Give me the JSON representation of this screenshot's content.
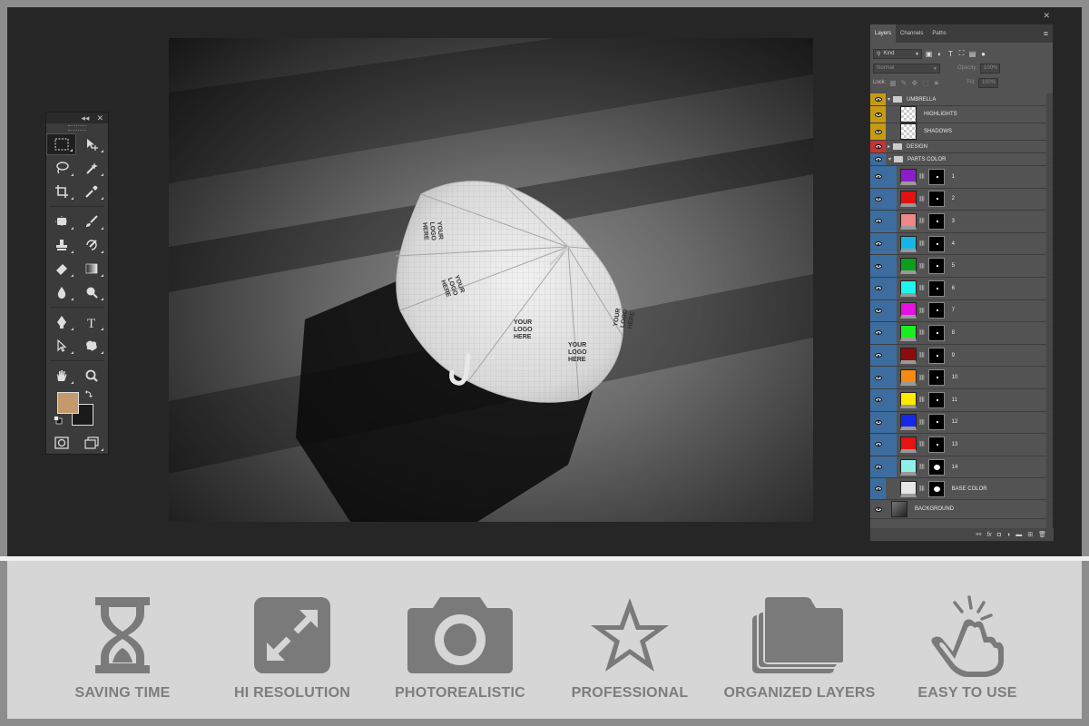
{
  "layers_panel": {
    "tabs": [
      {
        "label": "Layers",
        "active": true
      },
      {
        "label": "Channels",
        "active": false
      },
      {
        "label": "Paths",
        "active": false
      }
    ],
    "filter_kind": "Kind",
    "blend_mode": "Normal",
    "opacity_label": "Opacity:",
    "opacity_value": "100%",
    "lock_label": "Lock:",
    "fill_label": "Fill:",
    "fill_value": "100%",
    "layers": [
      {
        "name": "UMBRELLA",
        "type": "group",
        "color": "yellow",
        "expanded": true
      },
      {
        "name": "HIGHLIGHTS",
        "type": "smart",
        "color": "yellow"
      },
      {
        "name": "SHADOWS",
        "type": "smart",
        "color": "yellow"
      },
      {
        "name": "DESIGN",
        "type": "group",
        "color": "red",
        "expanded": false
      },
      {
        "name": "PARTS COLOR",
        "type": "group",
        "color": "blue",
        "expanded": true
      },
      {
        "name": "1",
        "type": "fill",
        "color": "blue",
        "swatch": "#8a1fc9"
      },
      {
        "name": "2",
        "type": "fill",
        "color": "blue",
        "swatch": "#e31111"
      },
      {
        "name": "3",
        "type": "fill",
        "color": "blue",
        "swatch": "#f08787"
      },
      {
        "name": "4",
        "type": "fill",
        "color": "blue",
        "swatch": "#17b5e6"
      },
      {
        "name": "5",
        "type": "fill",
        "color": "blue",
        "swatch": "#0e9e1d"
      },
      {
        "name": "6",
        "type": "fill",
        "color": "blue",
        "swatch": "#1ff5ee"
      },
      {
        "name": "7",
        "type": "fill",
        "color": "blue",
        "swatch": "#e511e3"
      },
      {
        "name": "8",
        "type": "fill",
        "color": "blue",
        "swatch": "#19f021"
      },
      {
        "name": "9",
        "type": "fill",
        "color": "blue",
        "swatch": "#8c0c0c"
      },
      {
        "name": "10",
        "type": "fill",
        "color": "blue",
        "swatch": "#f58c0f"
      },
      {
        "name": "11",
        "type": "fill",
        "color": "blue",
        "swatch": "#ffea00"
      },
      {
        "name": "12",
        "type": "fill",
        "color": "blue",
        "swatch": "#1629e8"
      },
      {
        "name": "13",
        "type": "fill",
        "color": "blue",
        "swatch": "#e51313"
      },
      {
        "name": "14",
        "type": "fill",
        "color": "blue",
        "swatch": "#8ff0ea"
      },
      {
        "name": "BASE COLOR",
        "type": "fill",
        "color": "blue",
        "swatch": "#e6e6e6"
      },
      {
        "name": "BACKGROUND",
        "type": "smart",
        "color": "plain"
      }
    ]
  },
  "tools": {
    "foreground_color": "#c49a6c",
    "background_color": "#1a1a1a"
  },
  "canvas": {
    "umbrella_prints": [
      "YOUR",
      "LOGO",
      "HERE"
    ]
  },
  "features": [
    {
      "label": "SAVING TIME",
      "icon": "hourglass-icon"
    },
    {
      "label": "HI RESOLUTION",
      "icon": "expand-icon"
    },
    {
      "label": "PHOTOREALISTIC",
      "icon": "camera-icon"
    },
    {
      "label": "PROFESSIONAL",
      "icon": "star-icon"
    },
    {
      "label": "ORGANIZED LAYERS",
      "icon": "layers-stack-icon"
    },
    {
      "label": "EASY TO USE",
      "icon": "tap-hand-icon"
    }
  ]
}
